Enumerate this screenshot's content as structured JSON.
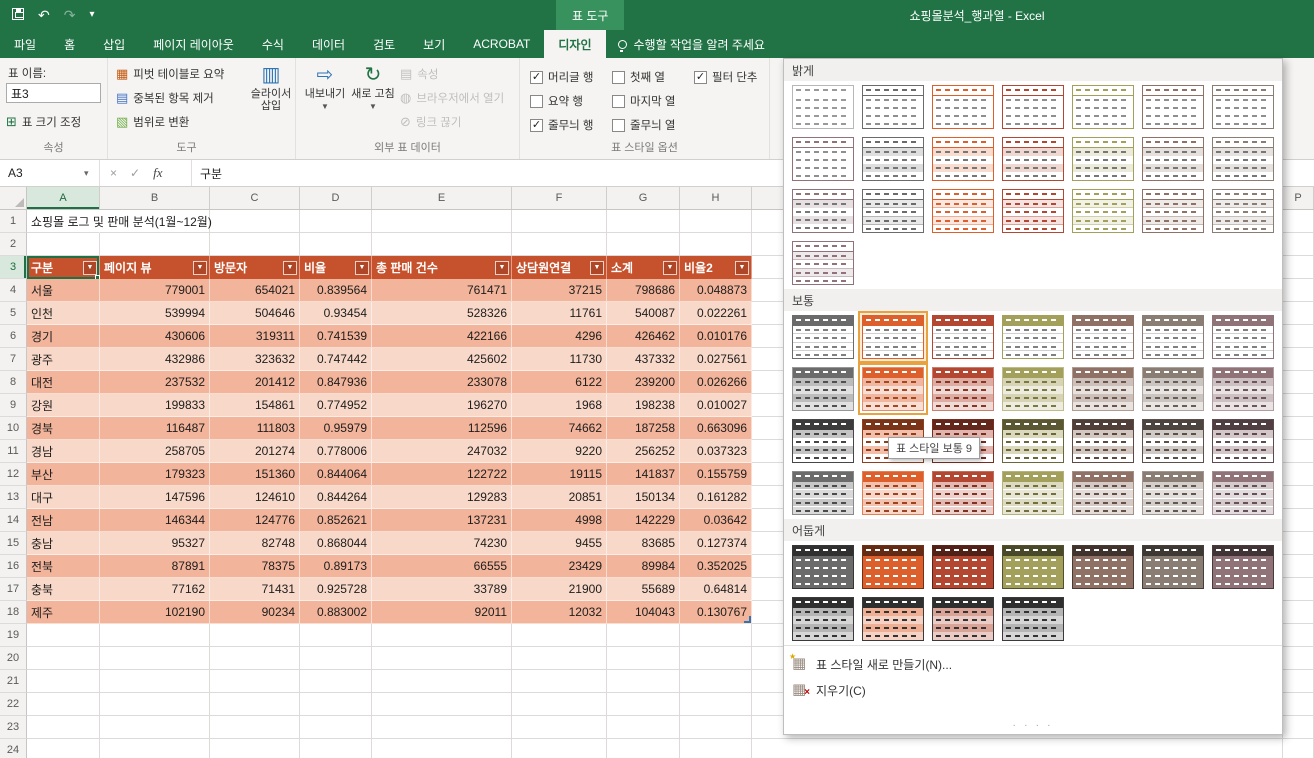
{
  "title_bar": {
    "title": "쇼핑몰분석_행과열 - Excel",
    "context_tab": "표 도구"
  },
  "ribbon_tabs": [
    {
      "label": "파일",
      "active": false
    },
    {
      "label": "홈",
      "active": false
    },
    {
      "label": "삽입",
      "active": false
    },
    {
      "label": "페이지 레이아웃",
      "active": false
    },
    {
      "label": "수식",
      "active": false
    },
    {
      "label": "데이터",
      "active": false
    },
    {
      "label": "검토",
      "active": false
    },
    {
      "label": "보기",
      "active": false
    },
    {
      "label": "ACROBAT",
      "active": false
    },
    {
      "label": "디자인",
      "active": true
    }
  ],
  "tell_me": "수행할 작업을 알려 주세요",
  "ribbon": {
    "properties_group": {
      "table_name_label": "표 이름:",
      "table_name_value": "표3",
      "resize_button": "표 크기 조정",
      "group_label": "속성"
    },
    "tools_group": {
      "buttons": [
        "피벗 테이블로 요약",
        "중복된 항목 제거",
        "범위로 변환"
      ],
      "slicer_button": "슬라이서 삽입",
      "group_label": "도구"
    },
    "external_group": {
      "export_button": "내보내기",
      "refresh_button": "새로 고침",
      "small_buttons": [
        "속성",
        "브라우저에서 열기",
        "링크 끊기"
      ],
      "group_label": "외부 표 데이터"
    },
    "style_options_group": {
      "checkboxes": [
        {
          "label": "머리글 행",
          "checked": true
        },
        {
          "label": "요약 행",
          "checked": false
        },
        {
          "label": "줄무늬 행",
          "checked": true
        },
        {
          "label": "첫째 열",
          "checked": false
        },
        {
          "label": "마지막 열",
          "checked": false
        },
        {
          "label": "줄무늬 열",
          "checked": false
        },
        {
          "label": "필터 단추",
          "checked": true
        }
      ],
      "group_label": "표 스타일 옵션"
    }
  },
  "formula_bar": {
    "name_box": "A3",
    "formula": "구분"
  },
  "grid": {
    "columns": [
      "A",
      "B",
      "C",
      "D",
      "E",
      "F",
      "G",
      "H"
    ],
    "right_column": "P",
    "row_count": 24,
    "selected_cell": "A3",
    "title_cell": "쇼핑몰 로그 및 판매 분석(1월~12월)",
    "table": {
      "headers": [
        "구분",
        "페이지 뷰",
        "방문자",
        "비율",
        "총 판매 건수",
        "상담원연결",
        "소계",
        "비율2"
      ],
      "data": [
        [
          "서울",
          "779001",
          "654021",
          "0.839564",
          "761471",
          "37215",
          "798686",
          "0.048873"
        ],
        [
          "인천",
          "539994",
          "504646",
          "0.93454",
          "528326",
          "11761",
          "540087",
          "0.022261"
        ],
        [
          "경기",
          "430606",
          "319311",
          "0.741539",
          "422166",
          "4296",
          "426462",
          "0.010176"
        ],
        [
          "광주",
          "432986",
          "323632",
          "0.747442",
          "425602",
          "11730",
          "437332",
          "0.027561"
        ],
        [
          "대전",
          "237532",
          "201412",
          "0.847936",
          "233078",
          "6122",
          "239200",
          "0.026266"
        ],
        [
          "강원",
          "199833",
          "154861",
          "0.774952",
          "196270",
          "1968",
          "198238",
          "0.010027"
        ],
        [
          "경북",
          "116487",
          "111803",
          "0.95979",
          "112596",
          "74662",
          "187258",
          "0.663096"
        ],
        [
          "경남",
          "258705",
          "201274",
          "0.778006",
          "247032",
          "9220",
          "256252",
          "0.037323"
        ],
        [
          "부산",
          "179323",
          "151360",
          "0.844064",
          "122722",
          "19115",
          "141837",
          "0.155759"
        ],
        [
          "대구",
          "147596",
          "124610",
          "0.844264",
          "129283",
          "20851",
          "150134",
          "0.161282"
        ],
        [
          "전남",
          "146344",
          "124776",
          "0.852621",
          "137231",
          "4998",
          "142229",
          "0.03642"
        ],
        [
          "충남",
          "95327",
          "82748",
          "0.868044",
          "74230",
          "9455",
          "83685",
          "0.127374"
        ],
        [
          "전북",
          "87891",
          "78375",
          "0.89173",
          "66555",
          "23429",
          "89984",
          "0.352025"
        ],
        [
          "충북",
          "77162",
          "71431",
          "0.925728",
          "33789",
          "21900",
          "55689",
          "0.64814"
        ],
        [
          "제주",
          "102190",
          "90234",
          "0.883002",
          "92011",
          "12032",
          "104043",
          "0.130767"
        ]
      ]
    }
  },
  "gallery": {
    "sections": [
      {
        "label": "밝게",
        "count": 22
      },
      {
        "label": "보통",
        "count": 28
      },
      {
        "label": "어둡게",
        "count": 11
      }
    ],
    "selected": {
      "section": 1,
      "index": 1
    },
    "hovered": {
      "section": 1,
      "index": 8
    },
    "tooltip": "표 스타일 보통 9",
    "menu": [
      {
        "label": "표 스타일 새로 만들기(N)..."
      },
      {
        "label": "지우기(C)"
      }
    ]
  },
  "icons": {
    "undo": "↶",
    "redo": "↷",
    "qat_more": "▾",
    "name_dropdown": "▾",
    "cancel": "×",
    "enter": "✓",
    "fx": "fx",
    "check": "✓",
    "filter": "▼",
    "dropdown": "▼",
    "pivot": "▦",
    "dedupe": "▤",
    "range": "▧",
    "slicer": "▥",
    "export": "⇨",
    "refresh": "↻",
    "props": "▤",
    "browser": "◍",
    "unlink": "⊘",
    "resize_table": "⊞",
    "table_grid": "▦",
    "star": "★",
    "clear_x": "×",
    "grip": "∙ ∙ ∙ ∙"
  },
  "colors": {
    "excel_green": "#217346",
    "context_tab_green": "#37925E",
    "table_header": "#C6512D",
    "band_dark": "#F2B49A",
    "band_light": "#F8D8C8",
    "selection_green": "#1F7145",
    "table_handle_blue": "#2E75B6",
    "gallery_highlight": "#E8A33E",
    "accents": [
      "#6B6B6B",
      "#DD5F2B",
      "#B44731",
      "#A3A05B",
      "#8F7265",
      "#8A7D73",
      "#907379"
    ]
  }
}
